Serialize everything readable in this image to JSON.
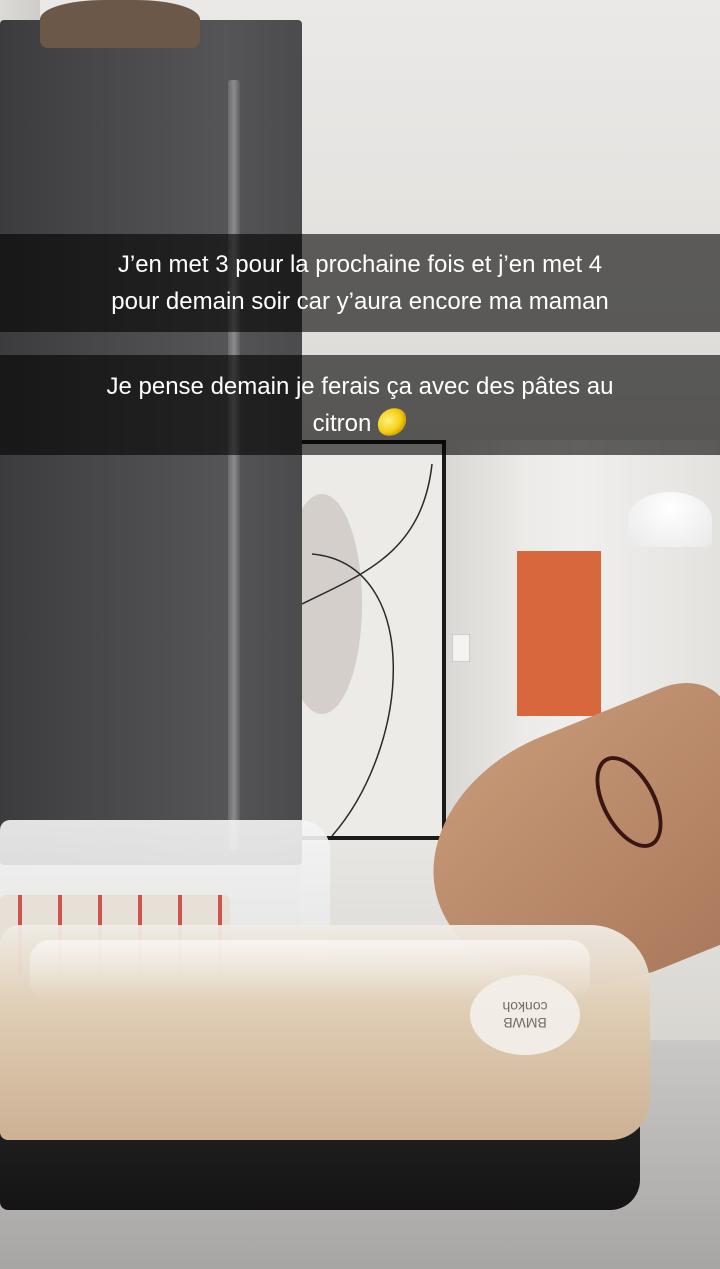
{
  "captions": [
    {
      "lines": [
        "J’en met 3 pour la prochaine fois et j’en met 4",
        "pour demain soir car y’aura encore ma maman"
      ]
    },
    {
      "lines": [
        "Je pense demain je ferais ça avec des pâtes au",
        "citron"
      ],
      "emoji": "lemon-icon"
    }
  ],
  "scene": {
    "bag_label": "BMWB\nconkoh"
  },
  "colors": {
    "caption_background": "#000000",
    "caption_text": "#ffffff",
    "fridge": "#4a4a4c",
    "artwork_orange": "#d9673d"
  }
}
